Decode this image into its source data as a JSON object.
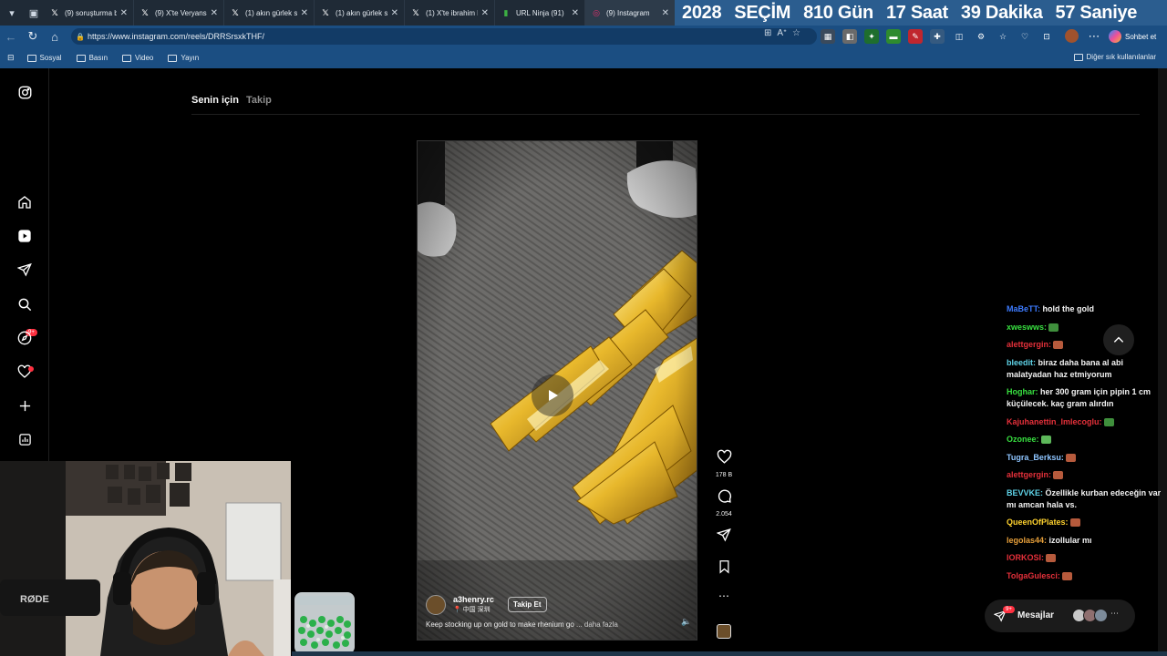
{
  "tabs": [
    {
      "icon": "x-icon",
      "title": "(9) soruşturma ba",
      "active": false
    },
    {
      "icon": "x-icon",
      "title": "(9) X'te Veryansın",
      "active": false
    },
    {
      "icon": "x-icon",
      "title": "(1) akın gürlek so",
      "active": false
    },
    {
      "icon": "x-icon",
      "title": "(1) akın gürlek so",
      "active": false
    },
    {
      "icon": "x-icon",
      "title": "(1) X'te ibrahim k",
      "active": false
    },
    {
      "icon": "urlninja-icon",
      "title": "URL Ninja (91)",
      "active": false
    },
    {
      "icon": "instagram-icon",
      "title": "(9) Instagram",
      "active": true
    }
  ],
  "countdown": {
    "parts": [
      "2028",
      "SEÇİM",
      "810 Gün",
      "17 Saat",
      "39 Dakika",
      "57 Saniye"
    ]
  },
  "address": {
    "url": "https://www.instagram.com/reels/DRRSrsxkTHF/"
  },
  "chat_button": "Sohbet et",
  "bookmarks": {
    "items": [
      "Sosyal",
      "Basın",
      "Video",
      "Yayın"
    ],
    "other": "Diğer sık kullanılanlar"
  },
  "feed": {
    "tab_for_you": "Senin için",
    "tab_following": "Takip"
  },
  "reel": {
    "username": "a3henry.rc",
    "location": "中国 深圳",
    "follow": "Takip Et",
    "caption": "Keep stocking up on gold to make rhenium go",
    "more": "... daha fazla",
    "likes": "178 B",
    "comments": "2.054"
  },
  "nav": {
    "notif_badge": "9+"
  },
  "messages": {
    "label": "Mesajlar",
    "badge": "9+"
  },
  "chat": [
    {
      "user": "MaBeTT:",
      "color": "#3d7bff",
      "text": "hold the gold",
      "emote": ""
    },
    {
      "user": "xweswws:",
      "color": "#38e040",
      "text": "",
      "emote": "#3f8f3c"
    },
    {
      "user": "alettgergin:",
      "color": "#e5303a",
      "text": "",
      "emote": "#b65a3c"
    },
    {
      "user": "bleedit:",
      "color": "#5fd3e8",
      "text": "biraz daha bana al abi malatyadan haz etmiyorum",
      "emote": ""
    },
    {
      "user": "Hoghar:",
      "color": "#38e040",
      "text": "her 300 gram için pipin 1 cm küçülecek. kaç gram alırdın",
      "emote": ""
    },
    {
      "user": "Kajuhanettin_Imlecoglu:",
      "color": "#e5303a",
      "text": "",
      "emote": "#3f8f3c"
    },
    {
      "user": "Ozonee:",
      "color": "#38e040",
      "text": "",
      "emote": "#5db85a"
    },
    {
      "user": "Tugra_Berksu:",
      "color": "#8ec5ff",
      "text": "",
      "emote": "#b65a3c"
    },
    {
      "user": "alettgergin:",
      "color": "#e5303a",
      "text": "",
      "emote": "#b65a3c"
    },
    {
      "user": "BEVVKE:",
      "color": "#5fd3e8",
      "text": "Özellikle kurban edeceğin var mı amcan hala vs.",
      "emote": ""
    },
    {
      "user": "QueenOfPlates:",
      "color": "#ffd22e",
      "text": "",
      "emote": "#b65a3c"
    },
    {
      "user": "legolas44:",
      "color": "#e8a03a",
      "text": "izollular mı",
      "emote": ""
    },
    {
      "user": "IORKOSI:",
      "color": "#e5303a",
      "text": "",
      "emote": "#b65a3c"
    },
    {
      "user": "TolgaGulesci:",
      "color": "#e5303a",
      "text": "",
      "emote": "#b65a3c"
    }
  ],
  "colors": {
    "countdown_bg": "#2b5d8f",
    "browser_bar": "#1b4e82",
    "ig_bg": "#000000",
    "notif_red": "#ff3040"
  }
}
